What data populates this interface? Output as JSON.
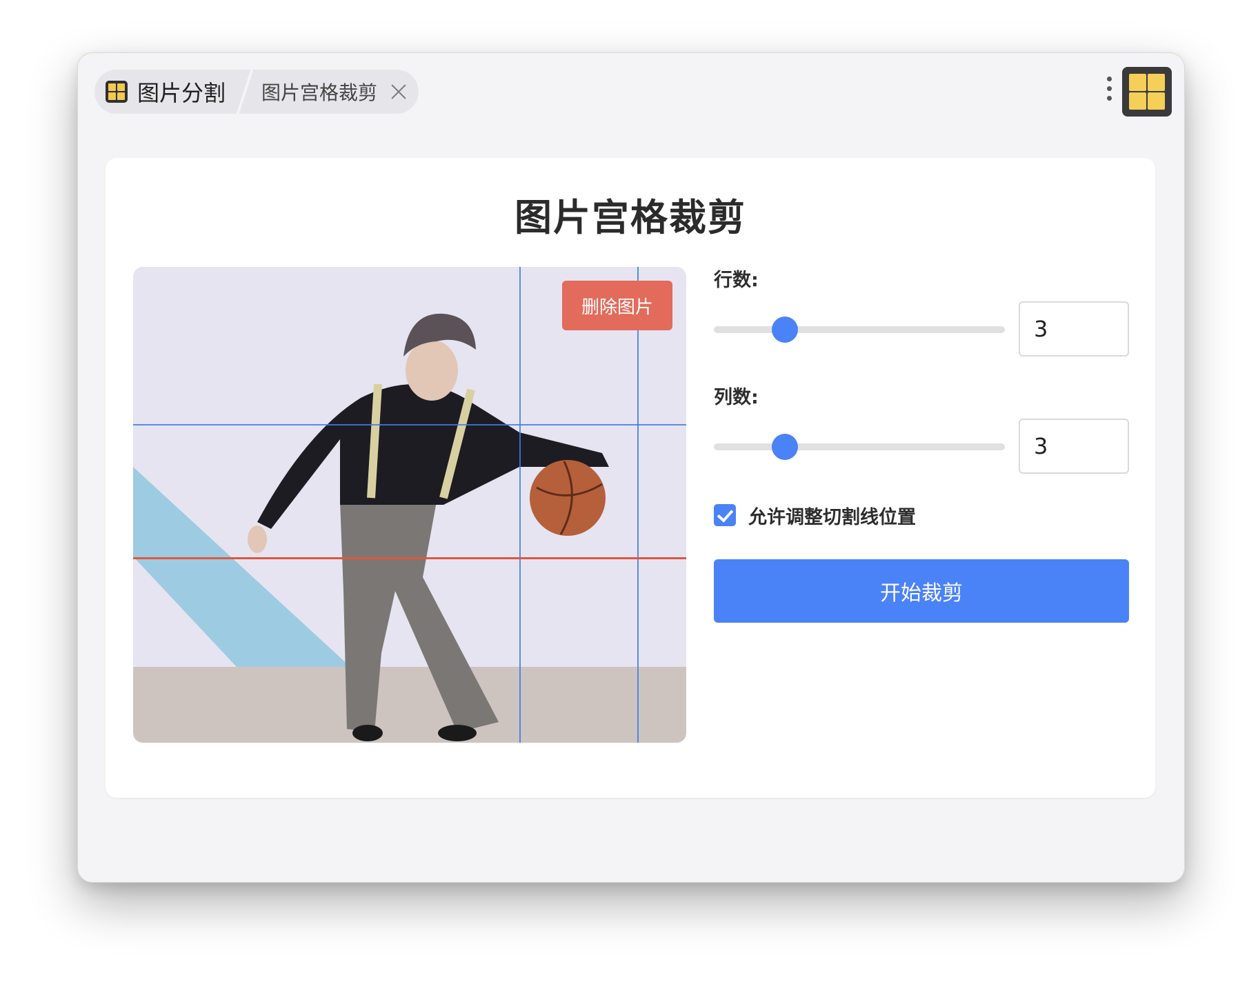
{
  "tabs": {
    "app_label": "图片分割",
    "doc_label": "图片宫格裁剪"
  },
  "page": {
    "title": "图片宫格裁剪"
  },
  "preview": {
    "delete_label": "删除图片"
  },
  "controls": {
    "rows_label": "行数:",
    "rows_value": "3",
    "cols_label": "列数:",
    "cols_value": "3",
    "adjust_label": "允许调整切割线位置",
    "adjust_checked": true,
    "start_label": "开始裁剪"
  },
  "colors": {
    "accent": "#4a82f7",
    "danger": "#e26b5b",
    "icon_yellow": "#f5cf57"
  }
}
